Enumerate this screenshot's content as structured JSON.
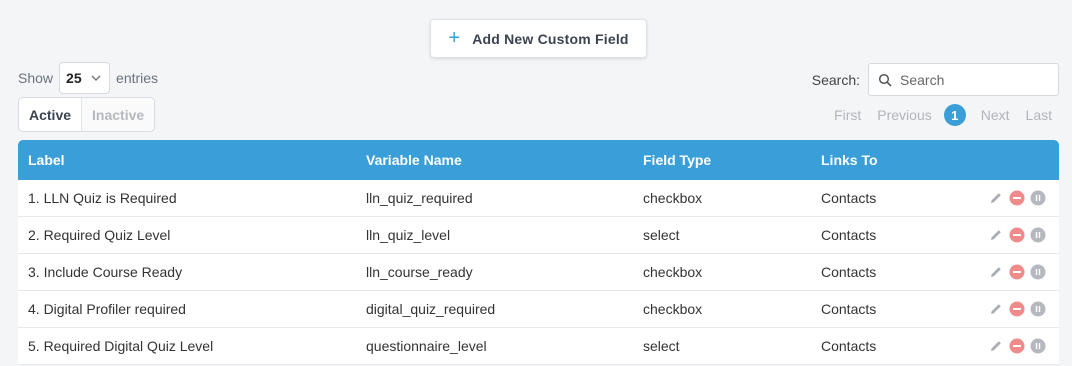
{
  "toolbar": {
    "add_label": "Add New Custom Field",
    "plus_icon": "+"
  },
  "length": {
    "show_label": "Show",
    "value": "25",
    "entries_label": "entries"
  },
  "search": {
    "label": "Search:",
    "placeholder": "Search"
  },
  "filter_tabs": {
    "active": "Active",
    "inactive": "Inactive"
  },
  "pagination": {
    "first": "First",
    "previous": "Previous",
    "current": "1",
    "next": "Next",
    "last": "Last"
  },
  "table": {
    "headers": [
      "Label",
      "Variable Name",
      "Field Type",
      "Links To"
    ],
    "rows": [
      {
        "label": "1. LLN Quiz is Required",
        "variable": "lln_quiz_required",
        "type": "checkbox",
        "links": "Contacts"
      },
      {
        "label": "2. Required Quiz Level",
        "variable": "lln_quiz_level",
        "type": "select",
        "links": "Contacts"
      },
      {
        "label": "3. Include Course Ready",
        "variable": "lln_course_ready",
        "type": "checkbox",
        "links": "Contacts"
      },
      {
        "label": "4. Digital Profiler required",
        "variable": "digital_quiz_required",
        "type": "checkbox",
        "links": "Contacts"
      },
      {
        "label": "5. Required Digital Quiz Level",
        "variable": "questionnaire_level",
        "type": "select",
        "links": "Contacts"
      }
    ]
  },
  "colors": {
    "accent": "#3a9fd8",
    "delete": "#ef8b8b",
    "pause": "#b5b9bf",
    "edit": "#a9aeb4"
  },
  "icons": {
    "edit": "pencil-icon",
    "delete": "minus-circle-icon",
    "pause": "pause-circle-icon",
    "search": "search-icon",
    "dropdown": "chevron-down-icon"
  }
}
